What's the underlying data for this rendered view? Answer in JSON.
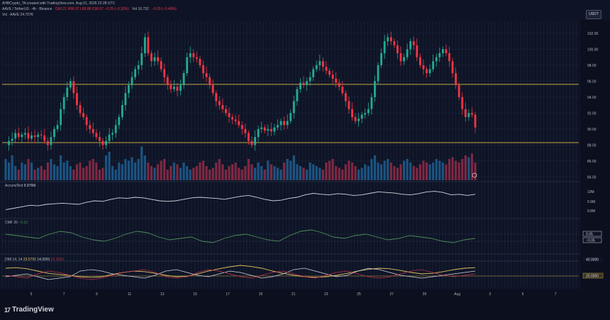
{
  "header": {
    "author_line": "AHBCrypto_TA created with TradingView.com, Aug 01, 2026 22:28 UTC",
    "symbol_line": "AAVE / TetherUS · 4h · Binance",
    "ohlc": "O90.21 H90.37 L89.88 C90.07 −0.29 (−0.32%)",
    "vol_main": "Vol 16.732",
    "vol_change": "−5.25 (−5.49%)",
    "vol_aave": "Vol · AAVE  24.707K",
    "currency": "USDT"
  },
  "indicators": {
    "accum_label": "Accum/Dist",
    "accum_value": "9.976M",
    "cmf_label": "CMF 20",
    "cmf_value": "−0.13",
    "dmi_label": "DMI 14, 14",
    "dmi_values": [
      "23.5792",
      "14.2091",
      "21.1932"
    ]
  },
  "colors": {
    "background": "#0e1426",
    "up": "#22ab94",
    "down": "#f23645",
    "vol_up": "#1e5a8c",
    "vol_down": "#8c2a46",
    "level_line": "#c9a646",
    "ad_line": "#d1d4dc",
    "cmf_line": "#4f8c5a",
    "adx_line": "#e0c060",
    "plus_di": "#d1d4dc",
    "minus_di": "#c0304a"
  },
  "axes": {
    "price_ticks": [
      "102.00",
      "100.00",
      "98.00",
      "96.00",
      "94.00",
      "92.00",
      "90.00",
      "88.00",
      "86.00",
      "84.00"
    ],
    "ad_ticks": [
      "10M",
      "9.9M",
      "9.8M"
    ],
    "cmf_tags": [
      "0.05",
      "−0.05"
    ],
    "dmi_tags": [
      "40.0000",
      "20.0000"
    ],
    "x_ticks": [
      "5",
      "7",
      "9",
      "11",
      "13",
      "15",
      "17",
      "19",
      "21",
      "23",
      "25",
      "27",
      "29",
      "Aug",
      "3",
      "5",
      "7"
    ]
  },
  "brand": {
    "logo": "tv-logo-icon",
    "name": "TradingView"
  },
  "chart_data": {
    "type": "candlestick",
    "title": "AAVE / TetherUS · 4h · Binance",
    "ylim": [
      83.5,
      103.5
    ],
    "horizontal_levels": [
      95.6,
      88.3
    ],
    "close_path": [
      88.0,
      88.5,
      88.8,
      89.5,
      89.0,
      89.3,
      89.5,
      88.8,
      89.2,
      89.0,
      89.3,
      89.2,
      88.5,
      88.0,
      89.0,
      90.0,
      90.5,
      92.5,
      94.0,
      95.2,
      96.0,
      94.5,
      93.0,
      92.0,
      91.5,
      90.5,
      90.0,
      89.5,
      89.0,
      88.5,
      88.0,
      88.5,
      89.3,
      89.5,
      90.5,
      91.5,
      93.0,
      94.5,
      95.5,
      96.5,
      97.5,
      98.0,
      99.5,
      101.5,
      99.5,
      98.5,
      99.0,
      98.5,
      97.5,
      96.5,
      95.5,
      95.0,
      95.3,
      94.8,
      95.5,
      97.0,
      99.0,
      99.5,
      99.0,
      98.8,
      98.0,
      97.0,
      96.5,
      95.5,
      94.5,
      93.5,
      93.0,
      92.5,
      92.0,
      91.5,
      91.2,
      91.0,
      90.5,
      90.0,
      89.5,
      88.5,
      88.0,
      89.0,
      90.0,
      90.2,
      89.8,
      90.0,
      89.7,
      90.2,
      90.5,
      91.0,
      90.5,
      91.0,
      92.0,
      93.5,
      95.0,
      95.8,
      95.5,
      96.0,
      96.5,
      97.5,
      98.0,
      98.5,
      97.8,
      97.3,
      96.8,
      96.3,
      95.8,
      95.3,
      94.5,
      93.5,
      92.5,
      91.5,
      91.0,
      91.3,
      91.8,
      92.0,
      92.5,
      94.0,
      96.0,
      98.0,
      99.5,
      101.0,
      101.5,
      101.0,
      100.5,
      99.5,
      98.5,
      99.0,
      100.0,
      101.0,
      100.5,
      99.0,
      98.0,
      97.5,
      97.0,
      97.5,
      98.5,
      99.0,
      99.5,
      100.0,
      99.5,
      98.5,
      97.0,
      95.5,
      94.0,
      92.5,
      91.5,
      92.0,
      91.8,
      90.2
    ],
    "volume_levels": [
      0.6,
      0.5,
      0.7,
      0.4,
      0.3,
      0.5,
      0.45,
      0.6,
      0.5,
      0.3,
      0.35,
      0.4,
      0.3,
      0.5,
      0.6,
      0.45,
      0.4,
      0.7,
      0.5,
      0.55,
      0.4,
      0.3,
      0.45,
      0.5,
      0.35,
      0.4,
      0.55,
      0.6,
      0.5,
      0.3,
      0.35,
      0.7,
      0.8,
      0.4,
      0.3,
      0.5,
      0.45,
      0.6,
      0.55,
      0.65,
      0.5,
      0.6,
      0.95,
      0.7,
      0.5,
      0.4,
      0.35,
      0.45,
      0.55,
      0.6,
      0.3,
      0.4,
      0.5,
      0.45,
      0.35,
      0.5,
      0.4,
      0.3,
      0.35,
      0.4,
      0.5,
      0.55,
      0.4,
      0.3,
      0.35,
      0.5,
      0.6,
      0.45,
      0.3,
      0.4,
      0.45,
      0.5,
      0.35,
      0.3,
      0.4,
      0.6,
      0.45,
      0.35,
      0.5,
      0.4,
      0.3,
      0.55,
      0.45,
      0.4,
      0.35,
      0.3,
      0.5,
      0.6,
      0.55,
      0.7,
      0.45,
      0.4,
      0.35,
      0.3,
      0.5,
      0.45,
      0.4,
      0.35,
      0.3,
      0.5,
      0.55,
      0.6,
      0.4,
      0.35,
      0.3,
      0.45,
      0.55,
      0.5,
      0.4,
      0.3,
      0.35,
      0.45,
      0.4,
      0.6,
      0.7,
      0.5,
      0.45,
      0.55,
      0.6,
      0.5,
      0.4,
      0.35,
      0.45,
      0.55,
      0.6,
      0.5,
      0.4,
      0.35,
      0.45,
      0.55,
      0.5,
      0.45,
      0.5,
      0.6,
      0.55,
      0.5,
      0.45,
      0.6,
      0.65,
      0.55,
      0.5,
      0.6,
      0.7,
      0.65,
      0.75,
      0.5
    ],
    "accum_dist": [
      0.2,
      0.25,
      0.3,
      0.35,
      0.33,
      0.38,
      0.4,
      0.42,
      0.4,
      0.38,
      0.45,
      0.5,
      0.48,
      0.55,
      0.6,
      0.58,
      0.62,
      0.6,
      0.55,
      0.5,
      0.48,
      0.5,
      0.55,
      0.6,
      0.62,
      0.6,
      0.58,
      0.55,
      0.6,
      0.65,
      0.68,
      0.62,
      0.55,
      0.5,
      0.52,
      0.58,
      0.62,
      0.7,
      0.75,
      0.72,
      0.7,
      0.74,
      0.72,
      0.68,
      0.7,
      0.75,
      0.8,
      0.78,
      0.76,
      0.72,
      0.7,
      0.74,
      0.8,
      0.82,
      0.78,
      0.7,
      0.72,
      0.68,
      0.72
    ],
    "cmf": [
      0.6,
      0.55,
      0.5,
      0.45,
      0.6,
      0.7,
      0.65,
      0.5,
      0.4,
      0.35,
      0.45,
      0.6,
      0.7,
      0.65,
      0.5,
      0.4,
      0.45,
      0.5,
      0.35,
      0.3,
      0.45,
      0.55,
      0.6,
      0.5,
      0.4,
      0.35,
      0.55,
      0.7,
      0.75,
      0.65,
      0.5,
      0.45,
      0.55,
      0.6,
      0.5,
      0.4,
      0.45,
      0.55,
      0.5,
      0.45,
      0.35,
      0.3,
      0.4,
      0.45
    ],
    "dmi": {
      "adx": [
        0.6,
        0.62,
        0.58,
        0.5,
        0.42,
        0.38,
        0.35,
        0.3,
        0.28,
        0.3,
        0.38,
        0.45,
        0.5,
        0.48,
        0.42,
        0.35,
        0.3,
        0.32,
        0.4,
        0.5,
        0.58,
        0.65,
        0.7,
        0.66,
        0.6,
        0.5,
        0.42,
        0.35,
        0.3,
        0.28,
        0.3,
        0.35,
        0.42,
        0.5,
        0.56,
        0.6,
        0.58,
        0.52,
        0.45,
        0.4,
        0.42,
        0.48,
        0.55,
        0.6,
        0.62
      ],
      "plus_di": [
        0.3,
        0.35,
        0.4,
        0.3,
        0.2,
        0.25,
        0.3,
        0.5,
        0.55,
        0.5,
        0.4,
        0.35,
        0.3,
        0.25,
        0.35,
        0.5,
        0.55,
        0.45,
        0.35,
        0.3,
        0.4,
        0.5,
        0.45,
        0.35,
        0.25,
        0.3,
        0.4,
        0.55,
        0.6,
        0.5,
        0.4,
        0.3,
        0.35,
        0.5,
        0.6,
        0.55,
        0.45,
        0.35,
        0.3,
        0.25,
        0.3,
        0.35,
        0.4,
        0.45,
        0.5
      ],
      "minus_di": [
        0.35,
        0.3,
        0.25,
        0.4,
        0.5,
        0.45,
        0.35,
        0.25,
        0.2,
        0.25,
        0.35,
        0.45,
        0.5,
        0.55,
        0.45,
        0.3,
        0.25,
        0.3,
        0.45,
        0.55,
        0.5,
        0.4,
        0.3,
        0.25,
        0.35,
        0.45,
        0.5,
        0.4,
        0.3,
        0.25,
        0.35,
        0.45,
        0.5,
        0.4,
        0.3,
        0.25,
        0.3,
        0.4,
        0.5,
        0.55,
        0.45,
        0.35,
        0.3,
        0.35,
        0.4
      ]
    },
    "ad_ylim": [
      9.75,
      10.05
    ],
    "cmf_ylim": [
      -0.15,
      0.15
    ],
    "dmi_ylim": [
      0,
      60
    ]
  }
}
